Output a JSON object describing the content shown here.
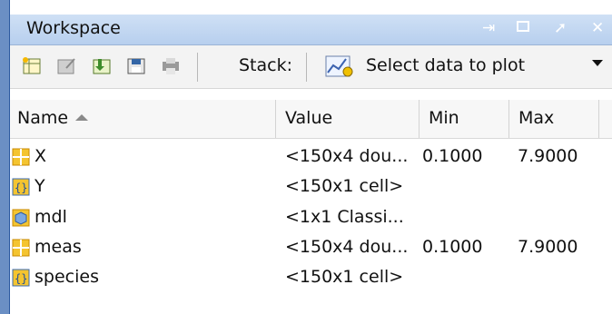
{
  "window": {
    "title": "Workspace"
  },
  "toolbar": {
    "stack_label": "Stack:",
    "plot_select": {
      "selected": "Select data to plot"
    }
  },
  "table": {
    "columns": [
      "Name",
      "Value",
      "Min",
      "Max"
    ],
    "rows": [
      {
        "icon": "matrix-icon",
        "name": "X",
        "value": "<150x4 dou...",
        "min": "0.1000",
        "max": "7.9000"
      },
      {
        "icon": "cell-array-icon",
        "name": "Y",
        "value": "<150x1 cell>",
        "min": "",
        "max": ""
      },
      {
        "icon": "object-icon",
        "name": "mdl",
        "value": "<1x1 Classi...",
        "min": "",
        "max": ""
      },
      {
        "icon": "matrix-icon",
        "name": "meas",
        "value": "<150x4 dou...",
        "min": "0.1000",
        "max": "7.9000"
      },
      {
        "icon": "cell-array-icon",
        "name": "species",
        "value": "<150x1 cell>",
        "min": "",
        "max": ""
      }
    ]
  },
  "colors": {
    "title_bar": "#bfd5f0",
    "accent": "#2d5aa0"
  }
}
